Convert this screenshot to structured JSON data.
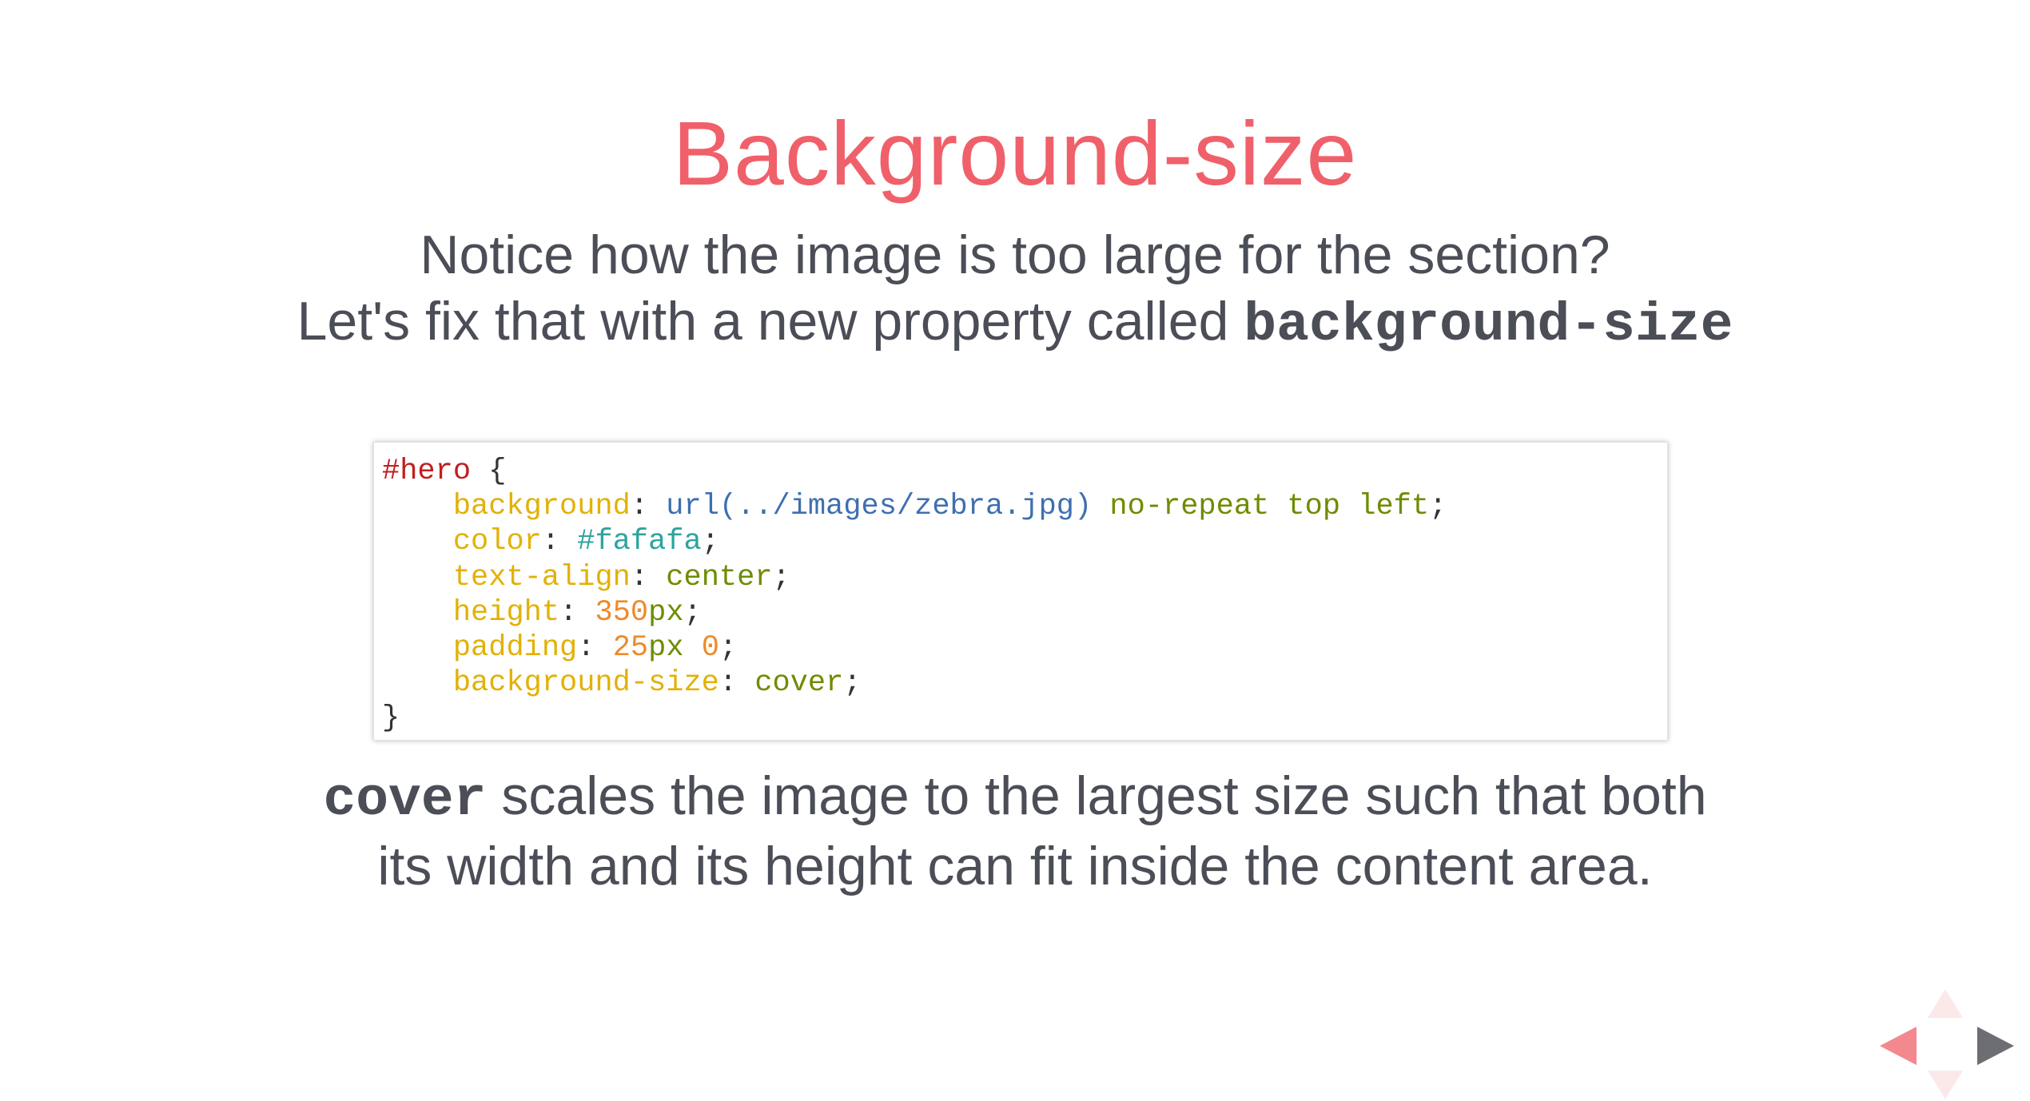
{
  "slide": {
    "title": "Background-size",
    "intro_line1": "Notice how the image is too large for the section?",
    "intro_line2_text": "Let's fix that with a new property called ",
    "intro_line2_code": "background-size",
    "code": {
      "selector": "#hero",
      "open_brace": " {",
      "lines": [
        {
          "prop": "background",
          "url": "url(../images/zebra.jpg)",
          "rest": " no-repeat top left"
        },
        {
          "prop": "color",
          "hex": "#fafafa"
        },
        {
          "prop": "text-align",
          "val": "center"
        },
        {
          "prop": "height",
          "num": "350",
          "unit": "px"
        },
        {
          "prop": "padding",
          "num1": "25",
          "unit1": "px",
          "num2": "0"
        },
        {
          "prop": "background-size",
          "val": "cover"
        }
      ],
      "close_brace": "}"
    },
    "outro_code": "cover",
    "outro_text": " scales the image to the largest size such that both its width and its height can fit inside the content area."
  },
  "navigation": {
    "up_icon": "arrow-up-icon",
    "down_icon": "arrow-down-icon",
    "left_icon": "arrow-left-icon",
    "right_icon": "arrow-right-icon"
  },
  "colors": {
    "title": "#f0606a",
    "body_text": "#4b4d57",
    "nav_left": "#f3888e",
    "nav_right": "#6d6d74",
    "nav_disabled": "#fbe9ea"
  }
}
